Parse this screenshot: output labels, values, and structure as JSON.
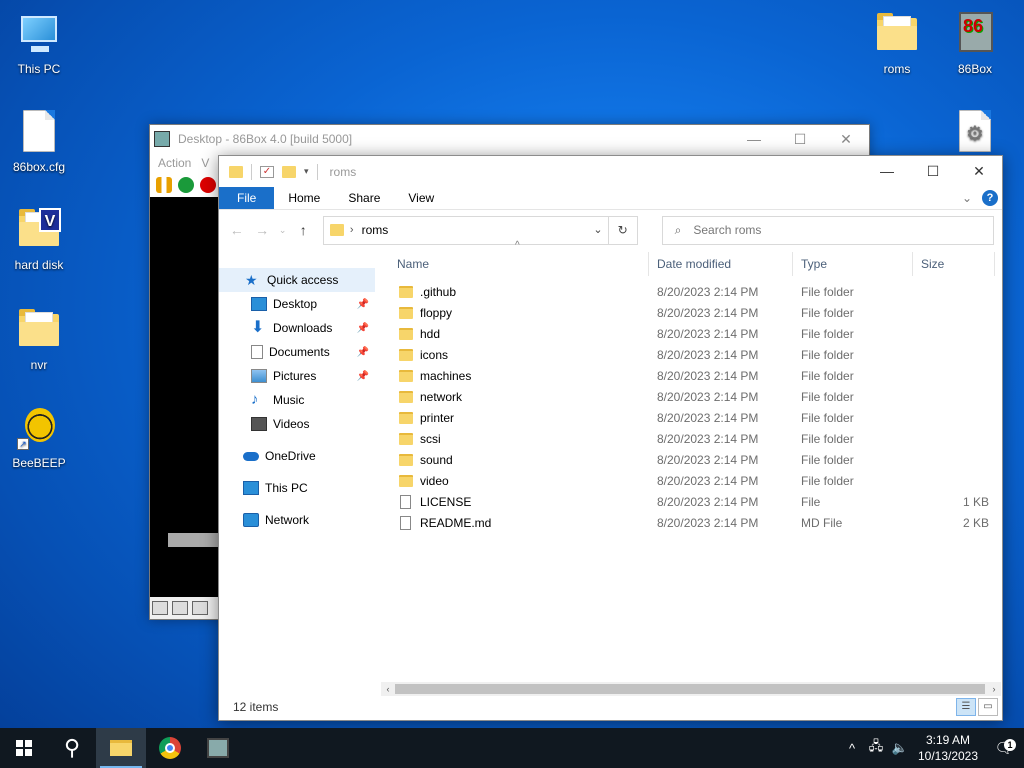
{
  "desktop": {
    "icons": [
      {
        "label": "This PC"
      },
      {
        "label": "86box.cfg"
      },
      {
        "label": "hard disk"
      },
      {
        "label": "nvr"
      },
      {
        "label": "BeeBEEP"
      },
      {
        "label": "roms"
      },
      {
        "label": "86Box"
      }
    ]
  },
  "box86": {
    "title": "Desktop - 86Box 4.0 [build 5000]",
    "menu": [
      "Action",
      "V"
    ],
    "controls": {
      "minimize": "—",
      "maximize": "☐",
      "close": "✕"
    }
  },
  "explorer": {
    "title": "roms",
    "controls": {
      "minimize": "—",
      "maximize": "☐",
      "close": "✕"
    },
    "ribbon_tabs": [
      "File",
      "Home",
      "Share",
      "View"
    ],
    "help_glyph": "?",
    "expand_glyph": "⌄",
    "address": {
      "path": "roms",
      "chevron": "›",
      "dropdown": "⌄",
      "refresh": "↻"
    },
    "nav_glyphs": {
      "back": "←",
      "forward": "→",
      "recent": "⌄",
      "up": "↑"
    },
    "search": {
      "placeholder": "Search roms",
      "icon_glyph": "⌕"
    },
    "nav_pane": {
      "quick_access": "Quick access",
      "pinned": [
        {
          "label": "Desktop",
          "pinned": true
        },
        {
          "label": "Downloads",
          "pinned": true
        },
        {
          "label": "Documents",
          "pinned": true
        },
        {
          "label": "Pictures",
          "pinned": true
        },
        {
          "label": "Music",
          "pinned": false
        },
        {
          "label": "Videos",
          "pinned": false
        }
      ],
      "pin_glyph": "📌",
      "onedrive": "OneDrive",
      "this_pc": "This PC",
      "network": "Network"
    },
    "columns": {
      "name": "Name",
      "date": "Date modified",
      "type": "Type",
      "size": "Size"
    },
    "sort_glyph": "^",
    "files": [
      {
        "name": ".github",
        "date": "8/20/2023 2:14 PM",
        "type": "File folder",
        "size": "",
        "kind": "folder"
      },
      {
        "name": "floppy",
        "date": "8/20/2023 2:14 PM",
        "type": "File folder",
        "size": "",
        "kind": "folder"
      },
      {
        "name": "hdd",
        "date": "8/20/2023 2:14 PM",
        "type": "File folder",
        "size": "",
        "kind": "folder"
      },
      {
        "name": "icons",
        "date": "8/20/2023 2:14 PM",
        "type": "File folder",
        "size": "",
        "kind": "folder"
      },
      {
        "name": "machines",
        "date": "8/20/2023 2:14 PM",
        "type": "File folder",
        "size": "",
        "kind": "folder"
      },
      {
        "name": "network",
        "date": "8/20/2023 2:14 PM",
        "type": "File folder",
        "size": "",
        "kind": "folder"
      },
      {
        "name": "printer",
        "date": "8/20/2023 2:14 PM",
        "type": "File folder",
        "size": "",
        "kind": "folder"
      },
      {
        "name": "scsi",
        "date": "8/20/2023 2:14 PM",
        "type": "File folder",
        "size": "",
        "kind": "folder"
      },
      {
        "name": "sound",
        "date": "8/20/2023 2:14 PM",
        "type": "File folder",
        "size": "",
        "kind": "folder"
      },
      {
        "name": "video",
        "date": "8/20/2023 2:14 PM",
        "type": "File folder",
        "size": "",
        "kind": "folder"
      },
      {
        "name": "LICENSE",
        "date": "8/20/2023 2:14 PM",
        "type": "File",
        "size": "1 KB",
        "kind": "file"
      },
      {
        "name": "README.md",
        "date": "8/20/2023 2:14 PM",
        "type": "MD File",
        "size": "2 KB",
        "kind": "file"
      }
    ],
    "status": "12 items",
    "scroll_glyphs": {
      "left": "‹",
      "right": "›"
    }
  },
  "taskbar": {
    "search_glyph": "⚲",
    "tray_glyphs": {
      "chevron": "^",
      "network": "🖧",
      "volume": "🔈",
      "notifications": "🗨"
    },
    "time": "3:19 AM",
    "date": "10/13/2023",
    "notification_count": "1"
  },
  "colors": {
    "accent": "#1a6fc9",
    "folder": "#f7d56a",
    "taskbar": "#101820"
  }
}
